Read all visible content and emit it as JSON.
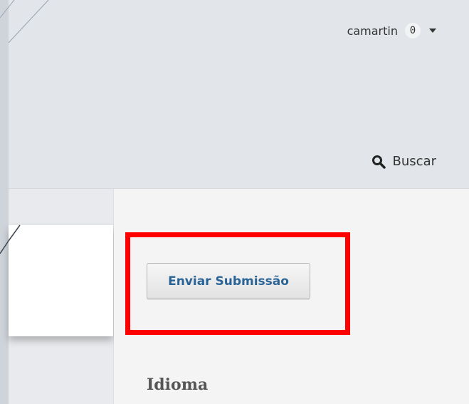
{
  "header": {
    "username": "camartin",
    "notification_count": "0",
    "search_label": "Buscar"
  },
  "sidebar": {
    "submit_button_label": "Enviar Submissão",
    "language_heading": "Idioma"
  },
  "colors": {
    "highlight": "#ff0000",
    "link_blue": "#2a6496",
    "header_bg": "#e2e5e9",
    "content_bg": "#f4f4f4"
  },
  "icons": [
    "search-icon",
    "caret-down-icon"
  ]
}
